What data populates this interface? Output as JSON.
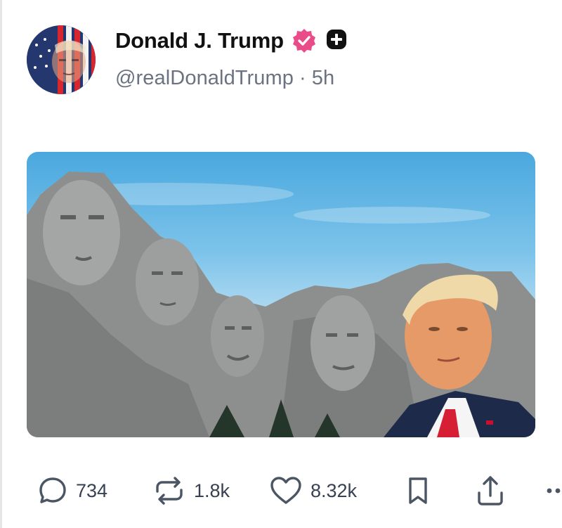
{
  "post": {
    "author": {
      "display_name": "Donald J. Trump",
      "handle": "@realDonaldTrump",
      "time_ago": "5h",
      "separator": "·",
      "verified_badge_icon": "verified-check-icon",
      "subscriber_badge_icon": "plus-badge-icon",
      "badge_color": "#ea4c89"
    },
    "media": {
      "kind": "image",
      "subject": "Mount Rushmore photo with a man in a suit and red tie on the right"
    },
    "actions": {
      "reply_count": "734",
      "repost_count": "1.8k",
      "like_count": "8.32k",
      "bookmark_icon": "bookmark-icon",
      "share_icon": "share-icon",
      "more_icon": "more-dots-icon"
    }
  },
  "colors": {
    "text": "#111111",
    "muted": "#6b7280",
    "accent": "#ea4c89"
  }
}
